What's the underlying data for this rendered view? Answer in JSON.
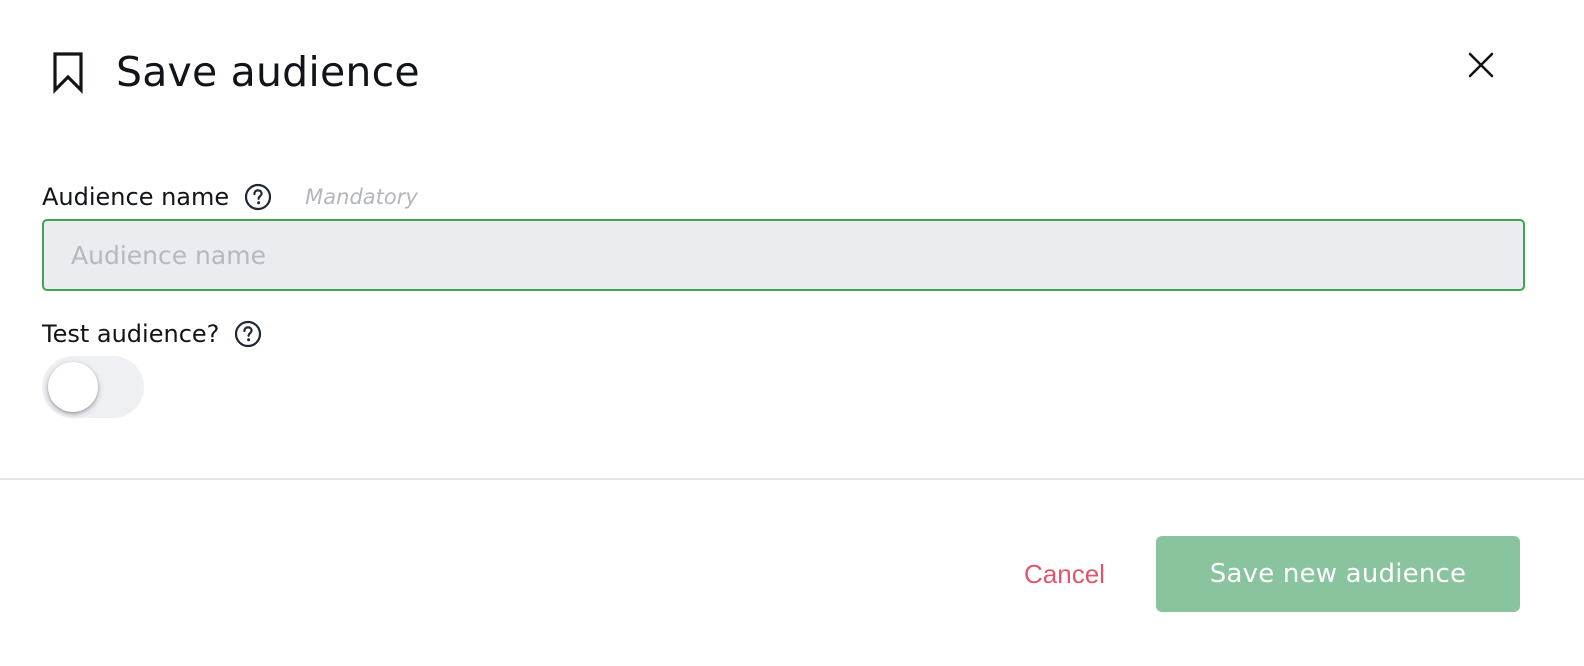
{
  "dialog": {
    "title": "Save audience",
    "title_icon": "bookmark-icon",
    "close_icon": "close-icon"
  },
  "audience_name": {
    "label": "Audience name",
    "help_icon": "help-icon",
    "mandatory_text": "Mandatory",
    "value": "",
    "placeholder": "Audience name"
  },
  "test_audience": {
    "label": "Test audience?",
    "help_icon": "help-icon",
    "enabled": false
  },
  "footer": {
    "cancel_label": "Cancel",
    "save_label": "Save new audience"
  },
  "colors": {
    "accent_green": "#3ea353",
    "save_button_bg": "#8ac49e",
    "cancel_text": "#e05670",
    "input_bg": "#eaecf0"
  }
}
